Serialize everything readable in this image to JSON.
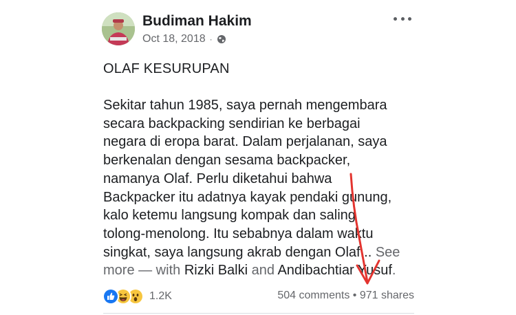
{
  "post": {
    "author": "Budiman Hakim",
    "date": "Oct 18, 2018",
    "separator": "·",
    "privacy_icon": "globe-icon",
    "options_icon": "more-options-icon",
    "title": "OLAF KESURUPAN",
    "body_lines": [
      "Sekitar tahun 1985, saya pernah mengembara",
      "secara backpacking sendirian ke berbagai",
      "negara di eropa barat. Dalam perjalanan, saya",
      "berkenalan dengan sesama backpacker,",
      "namanya Olaf. Perlu diketahui bahwa",
      "Backpacker itu adatnya kayak pendaki gunung,",
      "kalo ketemu langsung kompak dan saling",
      "tolong-menolong. Itu sebabnya dalam waktu",
      "singkat, saya langsung akrab dengan Olaf..."
    ],
    "see_more": "See",
    "more_with": "more — with",
    "tag_1": "Rizki Balki",
    "and_text": "and",
    "tag_2": "Andibachtiar Yusuf",
    "period": "."
  },
  "stats": {
    "reactions": [
      "like",
      "haha",
      "wow"
    ],
    "reaction_count": "1.2K",
    "comments": "504 comments",
    "dot": "•",
    "shares": "971 shares"
  },
  "colors": {
    "text": "#1c1e21",
    "muted": "#65676b",
    "like_blue": "#1877f2",
    "emoji_yellow": "#f7c63f",
    "arrow_red": "#e3342f"
  }
}
